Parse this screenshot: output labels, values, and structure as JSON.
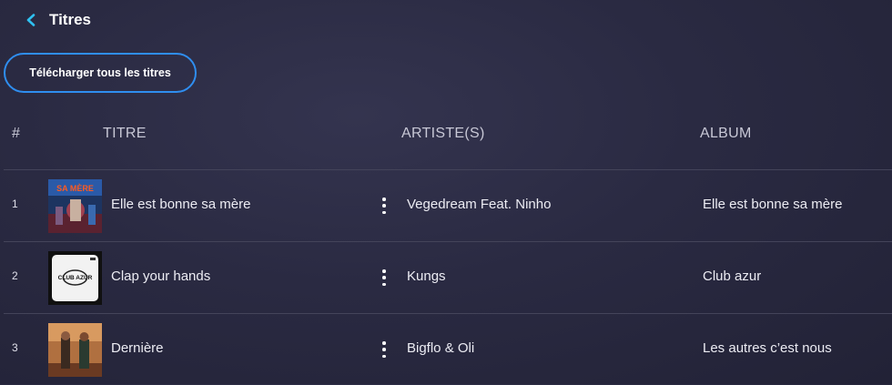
{
  "header": {
    "title": "Titres",
    "back_icon": "chevron-left-icon",
    "accent": "#2f8ef0"
  },
  "actions": {
    "download_all_label": "Télécharger tous les titres"
  },
  "table": {
    "headers": {
      "num": "#",
      "title": "TITRE",
      "artists": "ARTISTE(S)",
      "album": "ALBUM"
    },
    "rows": [
      {
        "num": "1",
        "title": "Elle est bonne sa mère",
        "artist": "Vegedream Feat. Ninho",
        "album": "Elle est bonne sa mère",
        "cover_text": "SA MÈRE"
      },
      {
        "num": "2",
        "title": "Clap your hands",
        "artist": "Kungs",
        "album": "Club azur",
        "cover_text": "CLUB AZUR"
      },
      {
        "num": "3",
        "title": "Dernière",
        "artist": "Bigflo & Oli",
        "album": "Les autres c’est nous"
      }
    ]
  }
}
